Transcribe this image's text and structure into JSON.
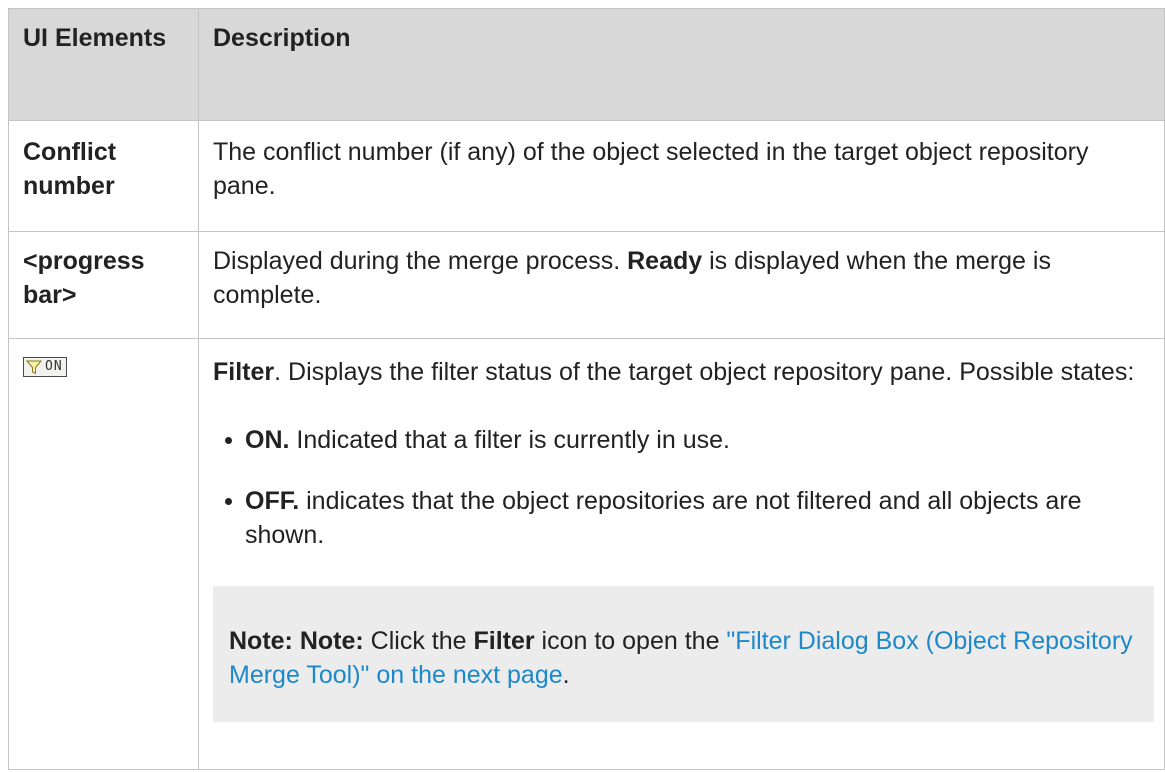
{
  "table": {
    "headers": {
      "ui_elements": "UI Elements",
      "description": "Description"
    },
    "rows": [
      {
        "ui_label": "Conflict number",
        "description": "The conflict number (if any) of the object selected in the target object repository pane."
      },
      {
        "ui_label": "<progress bar>",
        "desc_part1": "Displayed during the merge process. ",
        "desc_bold": "Ready",
        "desc_part2": " is displayed when the merge is complete."
      },
      {
        "ui_icon": "filter-on-icon",
        "ui_icon_text": "ON",
        "desc_bold": "Filter",
        "desc_text": ". Displays the filter status of the target object repository pane. Possible states:",
        "bullets": [
          {
            "bold": "ON.",
            "text": " Indicated that a filter is currently in use."
          },
          {
            "bold": "OFF.",
            "text": " indicates that the object repositories are not filtered and all objects are shown."
          }
        ],
        "note": {
          "label": "Note: Note:",
          "text1": " Click the ",
          "bold": "Filter",
          "text2": " icon to open the ",
          "link": "\"Filter Dialog Box (Object Repository Merge Tool)\" on the next page",
          "end": "."
        }
      }
    ]
  },
  "colors": {
    "header_bg": "#d8d8d8",
    "border": "#c5c5c5",
    "note_bg": "#ececec",
    "link": "#1e88c9"
  }
}
